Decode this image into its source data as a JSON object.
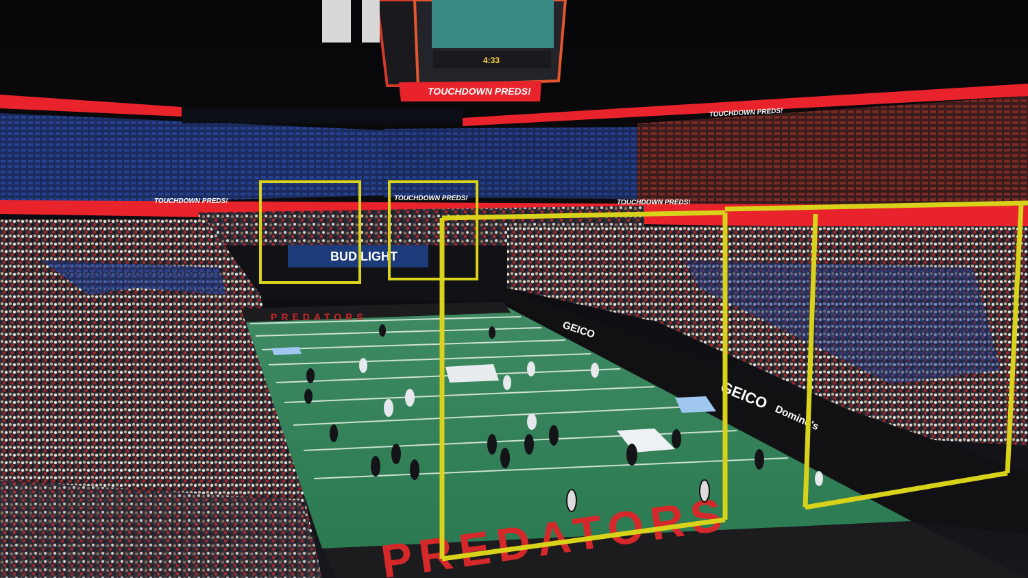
{
  "scene": {
    "description_free": true
  },
  "ribbon": {
    "upper_text": "TOUCHDOWN PREDS!",
    "lower_text_left": "TOUCHDOWN PREDS!",
    "lower_text_mid": "TOUCHDOWN PREDS!",
    "lower_text_right": "TOUCHDOWN PREDS!"
  },
  "scoreboard": {
    "under_text": "TOUCHDOWN PREDS!",
    "clock": "4:33"
  },
  "endzone": {
    "far_text": "PREDATORS",
    "near_text": "PREDATORS"
  },
  "ads": {
    "bud_light": "BUD LIGHT",
    "geico_far": "GEICO",
    "geico_near": "GEICO",
    "dominos": "Domino's"
  },
  "colors": {
    "turf": "#2f7d55",
    "ribbon": "#e8232b",
    "goalpost": "#d9d21b",
    "endzone": "#1c1c1e"
  }
}
